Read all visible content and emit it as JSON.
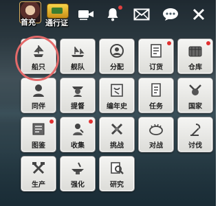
{
  "topbar": {
    "recharge_label": "首充",
    "pass_label": "通行证",
    "icons": [
      "video-icon",
      "bell-icon",
      "mail-icon",
      "chat-icon",
      "close-icon"
    ]
  },
  "menu": {
    "rows": [
      [
        {
          "label": "船只",
          "icon": "ship-icon",
          "badge": false,
          "selected": true
        },
        {
          "label": "舰队",
          "icon": "fleet-icon",
          "badge": false
        },
        {
          "label": "分配",
          "icon": "assign-icon",
          "badge": false
        },
        {
          "label": "订货",
          "icon": "order-icon",
          "badge": true
        },
        {
          "label": "仓库",
          "icon": "warehouse-icon",
          "badge": true
        }
      ],
      [
        {
          "label": "同伴",
          "icon": "companion-icon",
          "badge": false
        },
        {
          "label": "提督",
          "icon": "admiral-icon",
          "badge": false
        },
        {
          "label": "编年史",
          "icon": "chronicle-icon",
          "badge": false
        },
        {
          "label": "任务",
          "icon": "quest-icon",
          "badge": false
        },
        {
          "label": "国家",
          "icon": "nation-icon",
          "badge": false
        }
      ],
      [
        {
          "label": "图鉴",
          "icon": "codex-icon",
          "badge": true
        },
        {
          "label": "收集",
          "icon": "collect-icon",
          "badge": true
        },
        {
          "label": "挑战",
          "icon": "challenge-icon",
          "badge": false
        },
        {
          "label": "对战",
          "icon": "battle-icon",
          "badge": false
        },
        {
          "label": "讨伐",
          "icon": "crusade-icon",
          "badge": false
        }
      ],
      [
        {
          "label": "生产",
          "icon": "production-icon",
          "badge": false
        },
        {
          "label": "强化",
          "icon": "enhance-icon",
          "badge": false
        },
        {
          "label": "研究",
          "icon": "research-icon",
          "badge": false
        }
      ]
    ]
  },
  "colors": {
    "badge": "#e03030",
    "selection_ring": "#e36a6a",
    "tile": "#efefed"
  }
}
